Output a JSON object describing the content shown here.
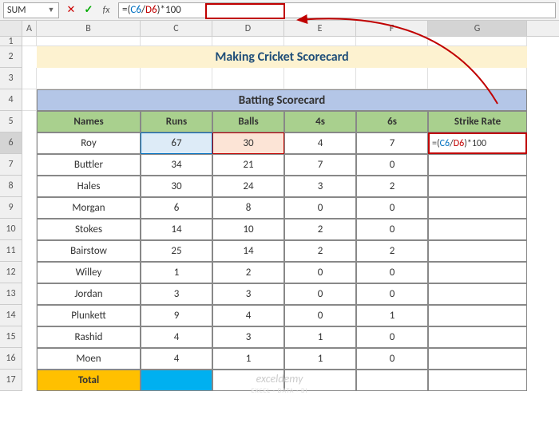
{
  "name_box": "SUM",
  "formula": "=(C6/D6)*100",
  "formula_parts": {
    "pre": "=(",
    "r1": "C6",
    "mid": "/",
    "r2": "D6",
    "post": ")*100"
  },
  "columns": [
    "A",
    "B",
    "C",
    "D",
    "E",
    "F",
    "G"
  ],
  "title": "Making Cricket Scorecard",
  "section_header": "Batting Scorecard",
  "headers": {
    "names": "Names",
    "runs": "Runs",
    "balls": "Balls",
    "fours": "4s",
    "sixes": "6s",
    "sr": "Strike Rate"
  },
  "total_label": "Total",
  "watermark": "exceldemy",
  "watermark_sub": "EXCEL · DATA · BI",
  "chart_data": {
    "type": "table",
    "columns": [
      "Names",
      "Runs",
      "Balls",
      "4s",
      "6s",
      "Strike Rate"
    ],
    "rows": [
      {
        "name": "Roy",
        "runs": 67,
        "balls": 30,
        "fours": 4,
        "sixes": 7,
        "sr": ""
      },
      {
        "name": "Buttler",
        "runs": 34,
        "balls": 21,
        "fours": 7,
        "sixes": 0,
        "sr": ""
      },
      {
        "name": "Hales",
        "runs": 30,
        "balls": 24,
        "fours": 3,
        "sixes": 2,
        "sr": ""
      },
      {
        "name": "Morgan",
        "runs": 6,
        "balls": 8,
        "fours": 0,
        "sixes": 0,
        "sr": ""
      },
      {
        "name": "Stokes",
        "runs": 14,
        "balls": 10,
        "fours": 2,
        "sixes": 0,
        "sr": ""
      },
      {
        "name": "Bairstow",
        "runs": 25,
        "balls": 14,
        "fours": 2,
        "sixes": 2,
        "sr": ""
      },
      {
        "name": "Willey",
        "runs": 1,
        "balls": 2,
        "fours": 0,
        "sixes": 0,
        "sr": ""
      },
      {
        "name": "Jordan",
        "runs": 3,
        "balls": 3,
        "fours": 0,
        "sixes": 0,
        "sr": ""
      },
      {
        "name": "Plunkett",
        "runs": 9,
        "balls": 4,
        "fours": 0,
        "sixes": 1,
        "sr": ""
      },
      {
        "name": "Rashid",
        "runs": 4,
        "balls": 3,
        "fours": 1,
        "sixes": 0,
        "sr": ""
      },
      {
        "name": "Moen",
        "runs": 4,
        "balls": 1,
        "fours": 1,
        "sixes": 0,
        "sr": ""
      }
    ]
  }
}
